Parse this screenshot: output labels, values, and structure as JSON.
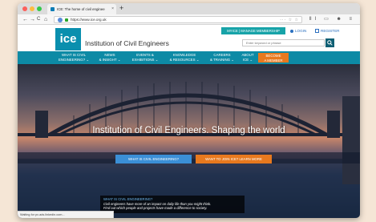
{
  "browser": {
    "tab_title": "ICE: The home of civil enginee",
    "tab_close": "×",
    "new_tab": "+",
    "url": "https://www.ice.org.uk",
    "url_actions": "··· ☆ ☆",
    "nav_back": "←",
    "nav_forward": "→",
    "nav_reload": "C",
    "nav_home": "⌂",
    "toolbar_icons": "ⅡⅠ ▭ ☻ ≡",
    "status_text": "Waiting for px.ads.linkedin.com..."
  },
  "header": {
    "logo_text": "ice",
    "site_name": "Institution of Civil Engineers",
    "manage_label": "MYICE | MANAGE MEMBERSHIP",
    "login_label": "LOGIN",
    "register_label": "REGISTER",
    "search_placeholder": "Enter keyword or phrase",
    "search_button_icon": "search-icon"
  },
  "nav": {
    "items": [
      {
        "line1": "WHAT IS CIVIL",
        "line2": "ENGINEERING? ⌄"
      },
      {
        "line1": "NEWS",
        "line2": "& INSIGHT ⌄"
      },
      {
        "line1": "EVENTS &",
        "line2": "EXHIBITIONS ⌄"
      },
      {
        "line1": "KNOWLEDGE",
        "line2": "& RESOURCES ⌄"
      },
      {
        "line1": "CAREERS",
        "line2": "& TRAINING ⌄"
      },
      {
        "line1": "ABOUT",
        "line2": "ICE ⌄"
      }
    ],
    "become_line1": "BECOME",
    "become_line2": "A MEMBER"
  },
  "hero": {
    "title": "Institution of Civil Engineers. Shaping the world",
    "cta_primary": "WHAT IS CIVIL ENGINEERING?",
    "cta_secondary": "WANT TO JOIN ICE? LEARN MORE",
    "info_heading": "WHAT IS CIVIL ENGINEERING?",
    "info_line1": "Civil engineers have more of an impact on daily life than you might think.",
    "info_line2": "Find out which people and projects have made a difference to society."
  },
  "colors": {
    "brand_teal": "#0d8aa5",
    "accent_orange": "#e8791e",
    "accent_blue": "#3b8fd6",
    "manage_teal": "#17a3a8"
  }
}
